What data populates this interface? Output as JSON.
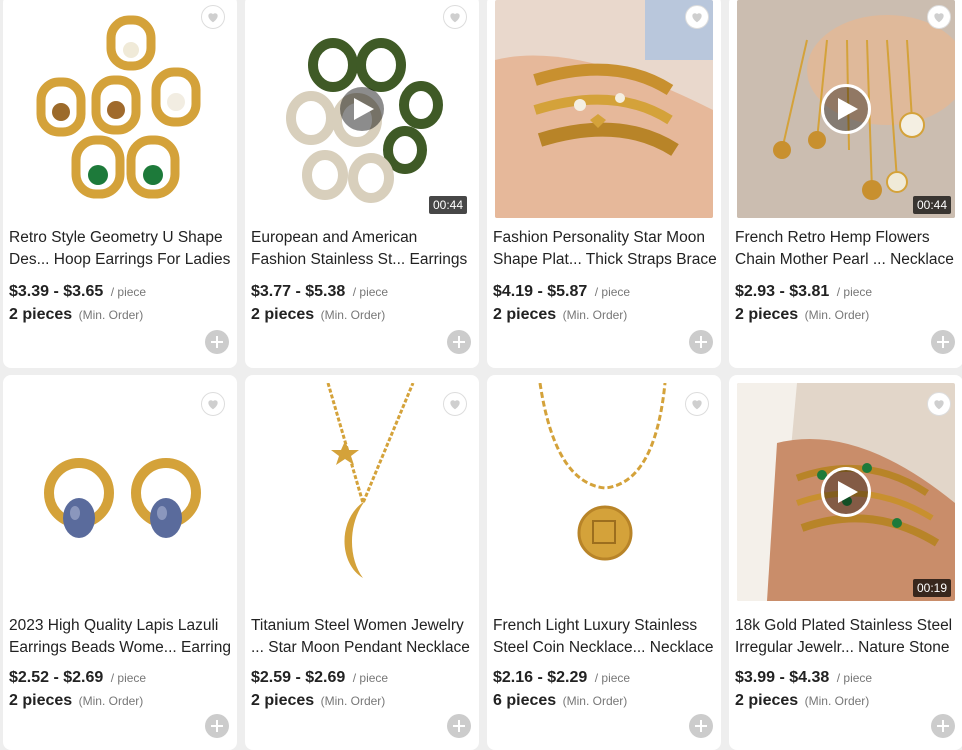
{
  "products": [
    {
      "title_line1": "Retro Style Geometry U Shape",
      "title_line2": "Des... Hoop Earrings For Ladies",
      "price": "$3.39 - $3.65",
      "unit": "/ piece",
      "moq": "2 pieces",
      "moq_label": "(Min. Order)",
      "duration": "",
      "has_video": false
    },
    {
      "title_line1": "European and American",
      "title_line2": "Fashion Stainless St... Earrings",
      "price": "$3.77 - $5.38",
      "unit": "/ piece",
      "moq": "2 pieces",
      "moq_label": "(Min. Order)",
      "duration": "00:44",
      "has_video": true
    },
    {
      "title_line1": "Fashion Personality Star Moon",
      "title_line2": "Shape Plat... Thick Straps Brace",
      "price": "$4.19 - $5.87",
      "unit": "/ piece",
      "moq": "2 pieces",
      "moq_label": "(Min. Order)",
      "duration": "",
      "has_video": false
    },
    {
      "title_line1": "French Retro Hemp Flowers",
      "title_line2": "Chain Mother Pearl ... Necklace",
      "price": "$2.93 - $3.81",
      "unit": "/ piece",
      "moq": "2 pieces",
      "moq_label": "(Min. Order)",
      "duration": "00:44",
      "has_video": true
    },
    {
      "title_line1": "2023 High Quality Lapis Lazuli",
      "title_line2": "Earrings Beads Wome... Earring",
      "price": "$2.52 - $2.69",
      "unit": "/ piece",
      "moq": "2 pieces",
      "moq_label": "(Min. Order)",
      "duration": "",
      "has_video": false
    },
    {
      "title_line1": "Titanium Steel Women Jewelry",
      "title_line2": "... Star Moon Pendant Necklace",
      "price": "$2.59 - $2.69",
      "unit": "/ piece",
      "moq": "2 pieces",
      "moq_label": "(Min. Order)",
      "duration": "",
      "has_video": false
    },
    {
      "title_line1": "French Light Luxury Stainless",
      "title_line2": "Steel Coin Necklace... Necklace",
      "price": "$2.16 - $2.29",
      "unit": "/ piece",
      "moq": "6 pieces",
      "moq_label": "(Min. Order)",
      "duration": "",
      "has_video": false
    },
    {
      "title_line1": "18k Gold Plated Stainless Steel",
      "title_line2": "Irregular Jewelr... Nature Stone",
      "price": "$3.99 - $4.38",
      "unit": "/ piece",
      "moq": "2 pieces",
      "moq_label": "(Min. Order)",
      "duration": "00:19",
      "has_video": true
    }
  ],
  "icons": {
    "favorite": "heart-icon",
    "add": "plus-icon",
    "video": "play-icon"
  },
  "colors": {
    "card": "#ffffff",
    "background": "#eeeeee",
    "gold": "#d4a23a",
    "add_button": "#cccccc"
  }
}
